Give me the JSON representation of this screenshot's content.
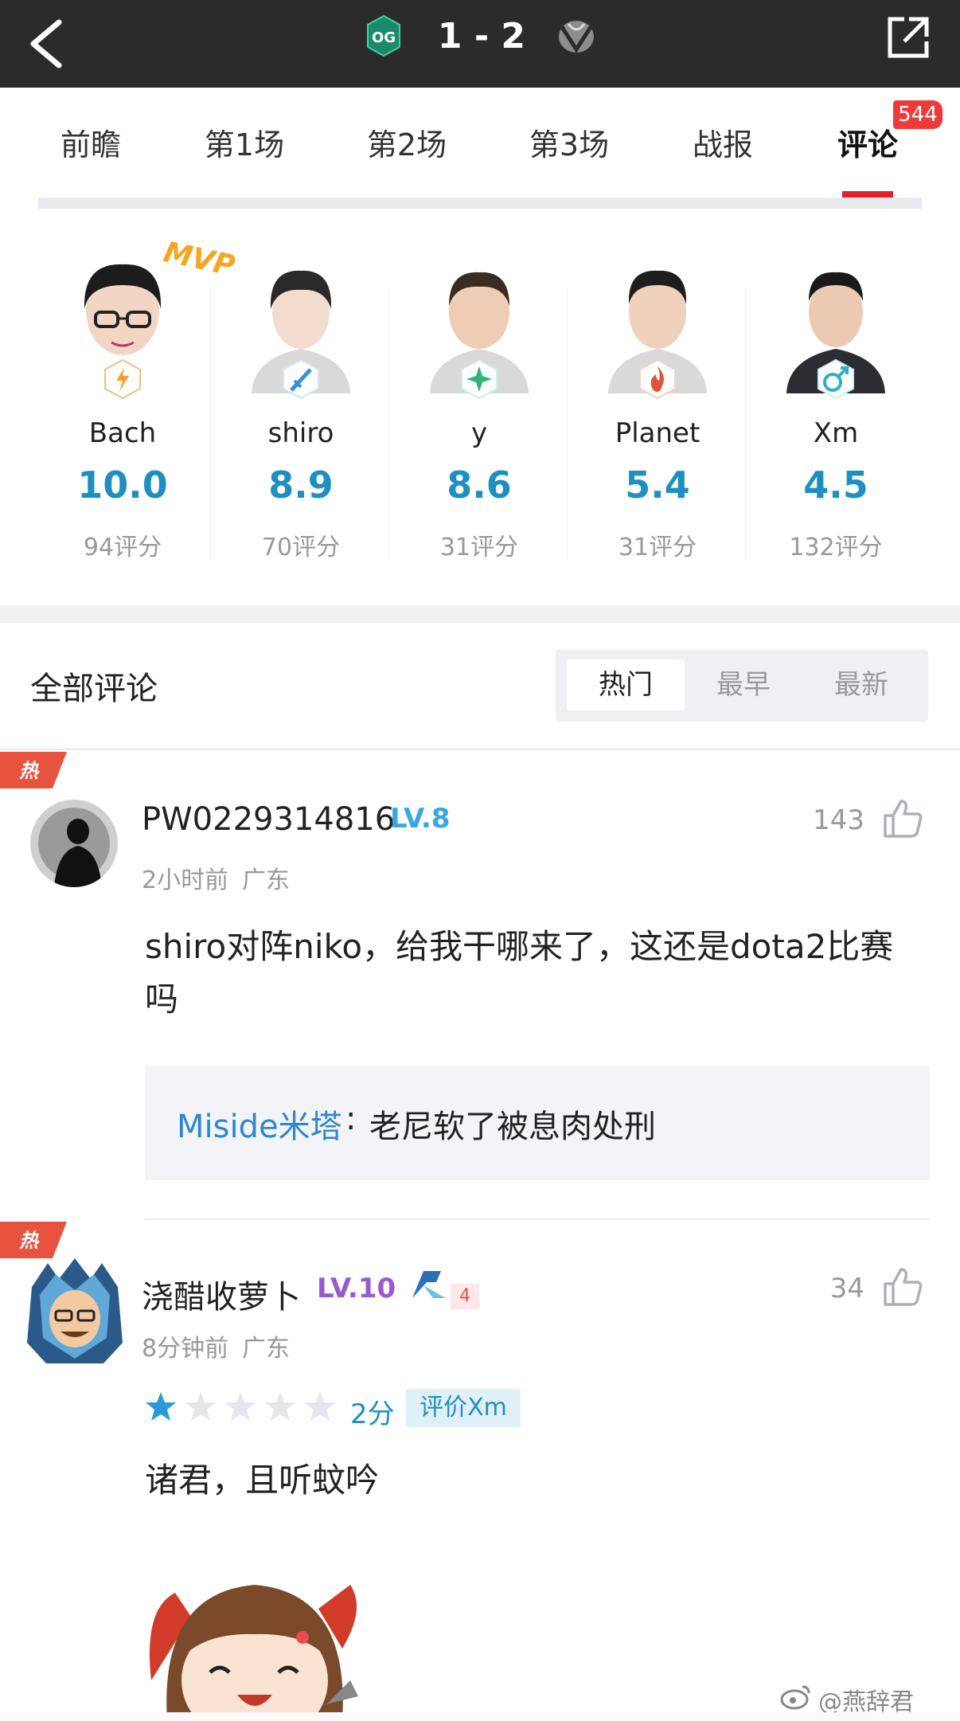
{
  "header": {
    "score": "1 - 2",
    "team_left": "OG",
    "team_right": "VG"
  },
  "tabs": [
    {
      "label": "前瞻"
    },
    {
      "label": "第1场"
    },
    {
      "label": "第2场"
    },
    {
      "label": "第3场"
    },
    {
      "label": "战报"
    },
    {
      "label": "评论",
      "badge": "544",
      "active": true
    }
  ],
  "players": [
    {
      "name": "Bach",
      "score": "10.0",
      "count": "94评分",
      "mvp": "MVP"
    },
    {
      "name": "shiro",
      "score": "8.9",
      "count": "70评分"
    },
    {
      "name": "y",
      "score": "8.6",
      "count": "31评分"
    },
    {
      "name": "Planet",
      "score": "5.4",
      "count": "31评分"
    },
    {
      "name": "Xm",
      "score": "4.5",
      "count": "132评分"
    }
  ],
  "comments_section": {
    "title": "全部评论",
    "sort": [
      "热门",
      "最早",
      "最新"
    ]
  },
  "comments": [
    {
      "hot": "热",
      "user": "PW0229314816",
      "level": "LV.8",
      "time": "2小时前",
      "location": "广东",
      "likes": "143",
      "text_line1": "shiro对阵niko，给我干哪来了，这还是dota2比赛",
      "text_line2": "吗",
      "reply_user": "Miside米塔",
      "reply_sep": ":",
      "reply_text": "老尼软了被息肉处刑"
    },
    {
      "hot": "热",
      "user": "浇醋收萝卜",
      "level": "LV.10",
      "team_num": "4",
      "time": "8分钟前",
      "location": "广东",
      "likes": "34",
      "rating": "2分",
      "rating_tag": "评价Xm",
      "rating_stars": 1,
      "text": "诸君，且听蚊吟"
    }
  ],
  "watermark": "@燕辞君",
  "colors": {
    "accent_red": "#e0212c",
    "score_blue": "#1f8fc2",
    "level_blue": "#3aa8e0",
    "level_purple": "#9b59d0",
    "reply_blue": "#2f86cf"
  }
}
